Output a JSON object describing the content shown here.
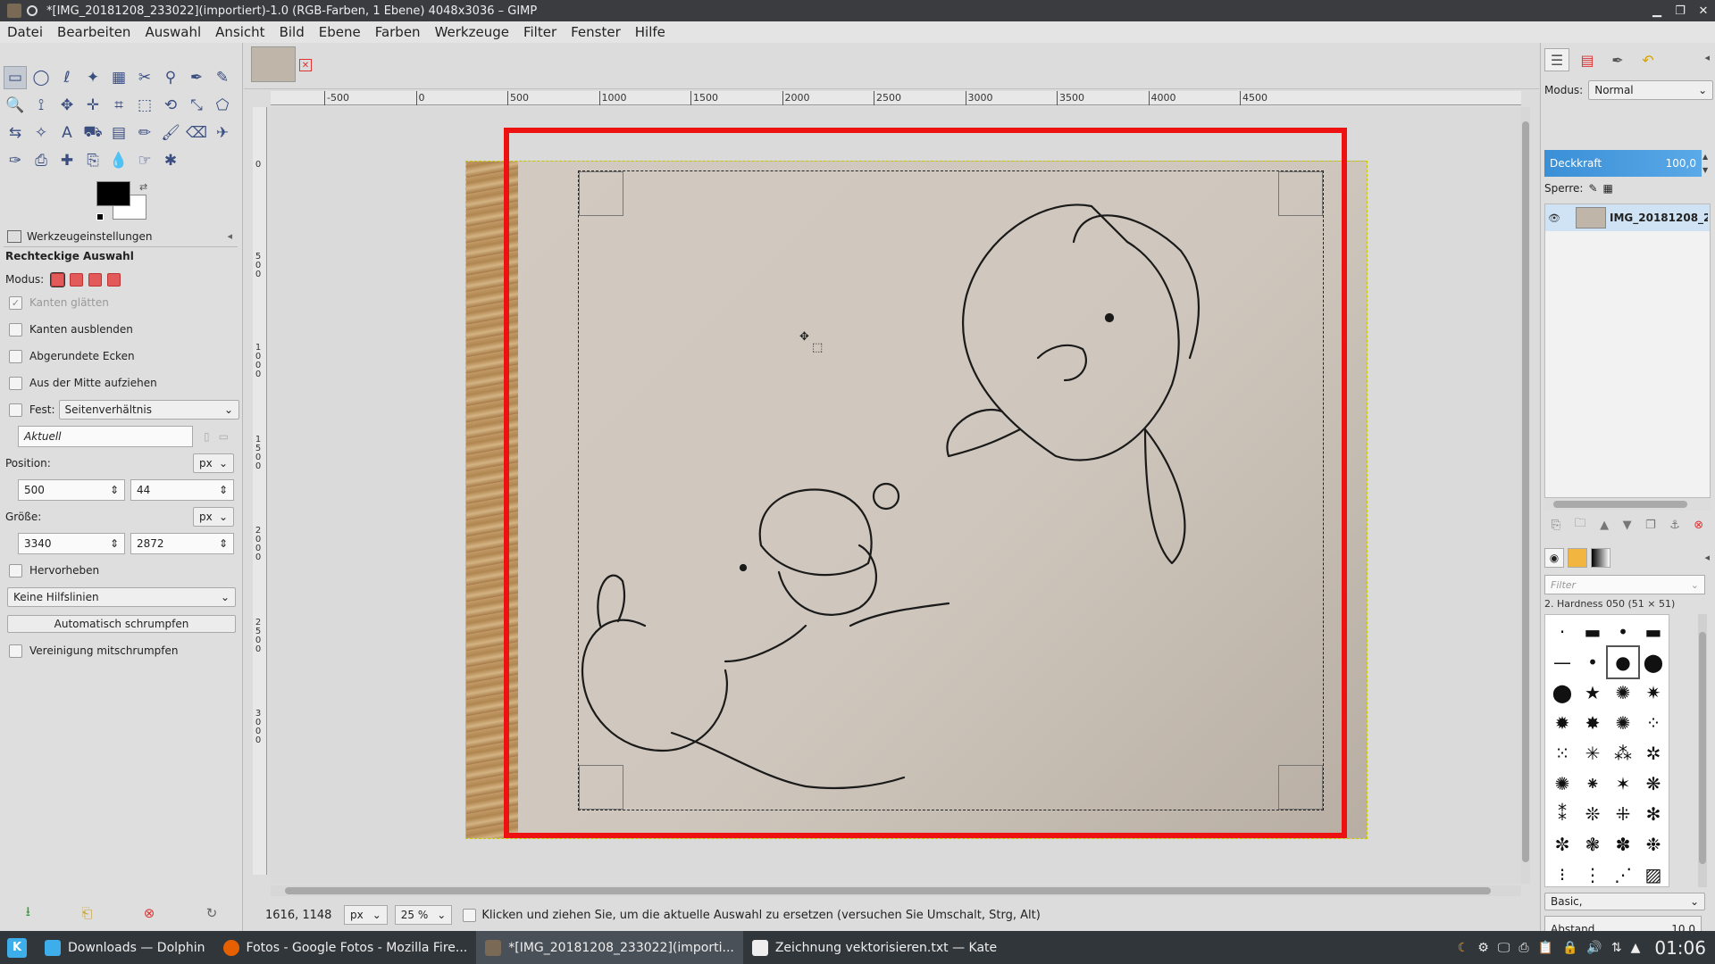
{
  "window": {
    "title": "*[IMG_20181208_233022](importiert)-1.0 (RGB-Farben, 1 Ebene) 4048x3036 – GIMP"
  },
  "menu": [
    "Datei",
    "Bearbeiten",
    "Auswahl",
    "Ansicht",
    "Bild",
    "Ebene",
    "Farben",
    "Werkzeuge",
    "Filter",
    "Fenster",
    "Hilfe"
  ],
  "toolbox": {
    "tools": [
      "rect-select",
      "ellipse-select",
      "free-select",
      "fuzzy-select",
      "select-by-color",
      "scissors",
      "foreground-select",
      "paths",
      "color-picker",
      "zoom",
      "measure",
      "move",
      "align",
      "crop",
      "unified-transform",
      "rotate",
      "scale",
      "perspective",
      "flip",
      "cage",
      "text",
      "bucket-fill",
      "gradient",
      "pencil",
      "paintbrush",
      "eraser",
      "airbrush",
      "ink",
      "clone",
      "heal",
      "perspective-clone",
      "blur",
      "smudge",
      "dodge-burn"
    ],
    "tool_glyphs": [
      "▭",
      "◯",
      "ℓ",
      "✦",
      "▦",
      "✂",
      "⚲",
      "✒",
      "✎",
      "🔍",
      "⟟",
      "✥",
      "✛",
      "⌗",
      "⬚",
      "⟲",
      "⤡",
      "⬠",
      "⇆",
      "✧",
      "A",
      "⛟",
      "▤",
      "✏",
      "🖌",
      "⌫",
      "✈",
      "✑",
      "⎙",
      "✚",
      "⎘",
      "💧",
      "☞",
      "✱"
    ],
    "fg_color": "#000000",
    "bg_color": "#ffffff"
  },
  "tool_options": {
    "tab_label": "Werkzeugeinstellungen",
    "title": "Rechteckige Auswahl",
    "mode_label": "Modus:",
    "antialias": "Kanten glätten",
    "feather": "Kanten ausblenden",
    "rounded": "Abgerundete Ecken",
    "expand_center": "Aus der Mitte aufziehen",
    "fixed_label": "Fest:",
    "fixed_value": "Seitenverhältnis",
    "aspect_value": "Aktuell",
    "position_label": "Position:",
    "position_unit": "px",
    "pos_x": "500",
    "pos_y": "44",
    "size_label": "Größe:",
    "size_unit": "px",
    "size_w": "3340",
    "size_h": "2872",
    "highlight": "Hervorheben",
    "guides": "Keine Hilfslinien",
    "autoshrink": "Automatisch schrumpfen",
    "shrink_merged": "Vereinigung mitschrumpfen"
  },
  "ruler": {
    "h_labels": [
      "-500",
      "0",
      "500",
      "1000",
      "1500",
      "2000",
      "2500",
      "3000",
      "3500",
      "4000",
      "4500"
    ],
    "v_labels": [
      "0",
      "500",
      "1000",
      "1500",
      "2000",
      "2500",
      "3000"
    ]
  },
  "status": {
    "coords": "1616, 1148",
    "unit": "px",
    "zoom": "25 %",
    "message": "Klicken und ziehen Sie, um die aktuelle Auswahl zu ersetzen (versuchen Sie Umschalt, Strg, Alt)"
  },
  "layers": {
    "mode_label": "Modus:",
    "mode_value": "Normal",
    "opacity_label": "Deckkraft",
    "opacity_value": "100,0",
    "lock_label": "Sperre:",
    "layer_name": "IMG_20181208_2"
  },
  "brushes": {
    "filter_placeholder": "Filter",
    "current": "2. Hardness 050 (51 × 51)",
    "set": "Basic,",
    "spacing_label": "Abstand",
    "spacing_value": "10,0",
    "glyphs": [
      "·",
      "▬",
      "•",
      "▬",
      "—",
      "•",
      "●",
      "⬤",
      "⬤",
      "★",
      "✺",
      "✷",
      "✹",
      "✸",
      "✺",
      "⁘",
      "⁙",
      "✳",
      "⁂",
      "✲",
      "✺",
      "⁕",
      "✶",
      "❋",
      "⁑",
      "❊",
      "⁜",
      "✻",
      "✼",
      "❃",
      "✽",
      "❉",
      "⁝",
      "⋮",
      "⋰",
      "▨"
    ]
  },
  "taskbar": {
    "tasks": [
      "Downloads — Dolphin",
      "Fotos - Google Fotos - Mozilla Fire...",
      "*[IMG_20181208_233022](importi...",
      "Zeichnung vektorisieren.txt — Kate"
    ],
    "clock": "01:06"
  }
}
